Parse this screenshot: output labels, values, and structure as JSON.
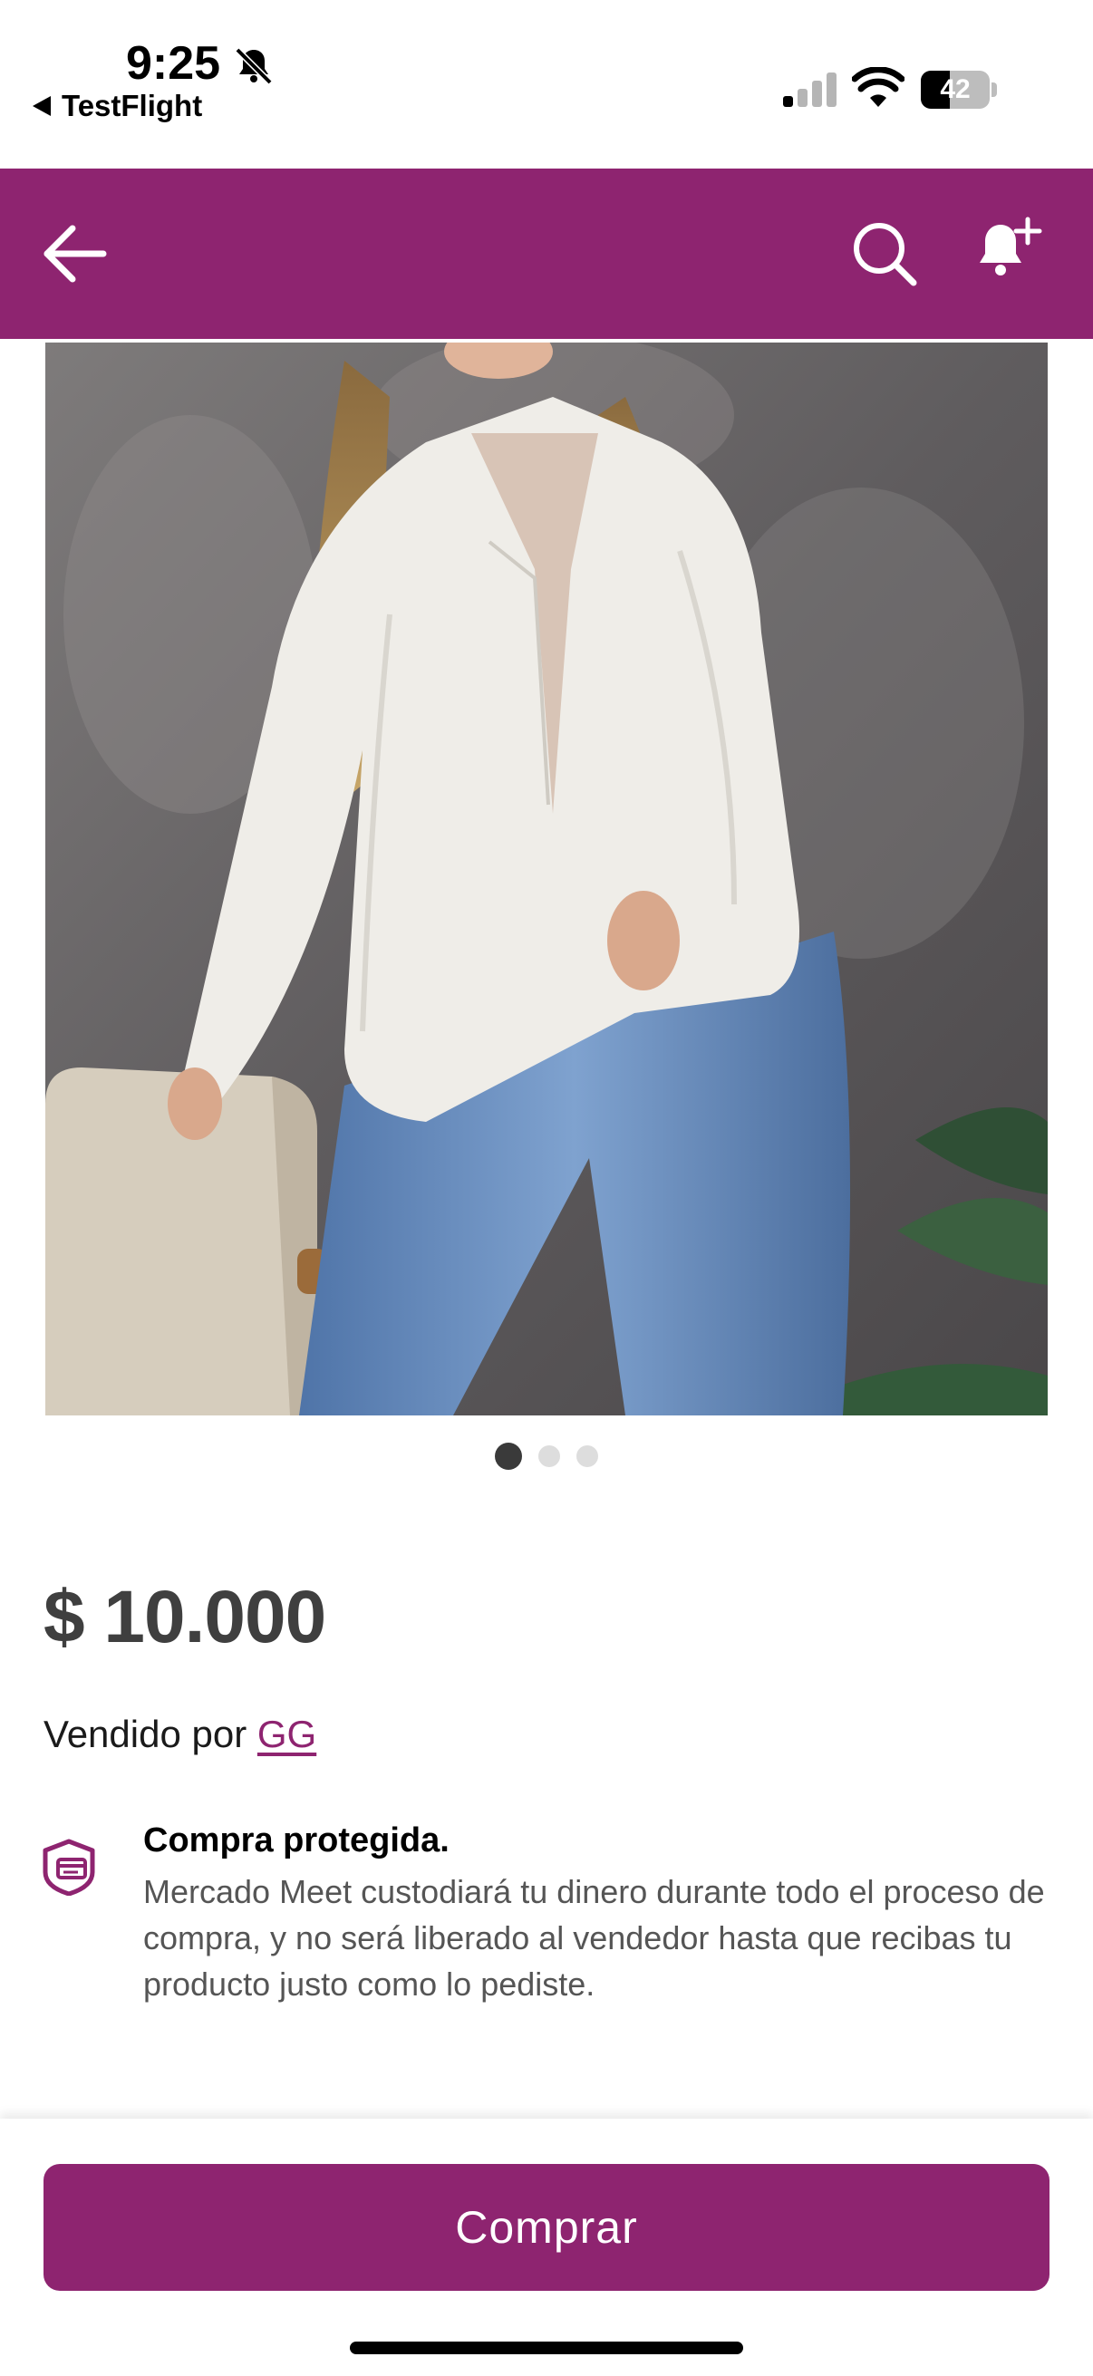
{
  "status_bar": {
    "time": "9:25",
    "back_app": "TestFlight",
    "battery_level": "42",
    "battery_fraction": 0.42,
    "signal_bars_active": 1,
    "signal_bars_total": 4
  },
  "header": {
    "background": "#8e2470",
    "back_icon": "arrow-left-icon",
    "search_icon": "search-icon",
    "notify_icon": "bell-plus-icon"
  },
  "gallery": {
    "image_count": 3,
    "active_index": 0
  },
  "product": {
    "price": "$ 10.000",
    "seller_prefix": "Vendido por ",
    "seller_name": "GG"
  },
  "protection": {
    "icon": "shield-card-icon",
    "title": "Compra protegida.",
    "text": "Mercado Meet custodiará tu dinero durante todo el proceso de compra, y no será liberado al vendedor hasta que recibas tu producto justo como lo pediste."
  },
  "actions": {
    "buy_label": "Comprar"
  },
  "colors": {
    "accent": "#8e2470",
    "price": "#3f3f3f",
    "body_text": "#555555"
  }
}
